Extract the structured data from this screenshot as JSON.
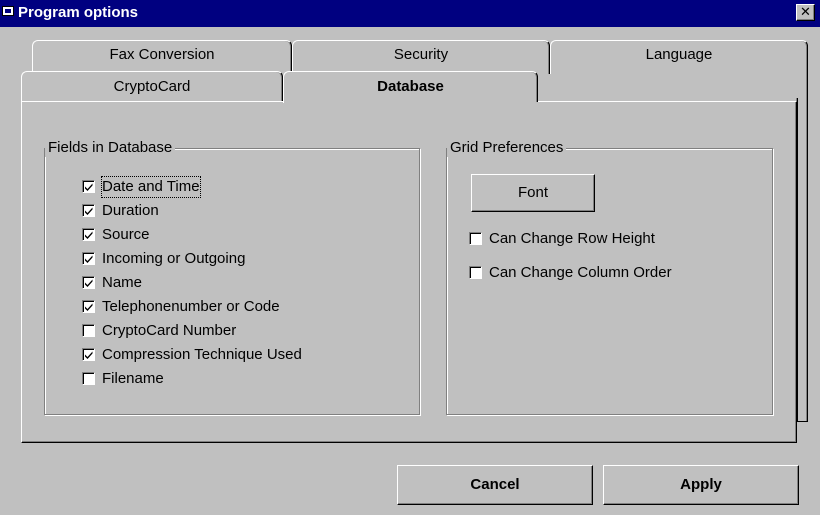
{
  "window": {
    "title": "Program options",
    "close_glyph": "✕"
  },
  "tabs": {
    "back_row": [
      {
        "label": "Fax Conversion"
      },
      {
        "label": "Security"
      },
      {
        "label": "Language"
      }
    ],
    "front_row": [
      {
        "label": "CryptoCard"
      },
      {
        "label": "Database",
        "selected": true
      }
    ]
  },
  "fields_group": {
    "title": "Fields in Database",
    "items": [
      {
        "label": "Date  and Time",
        "checked": true
      },
      {
        "label": "Duration",
        "checked": true
      },
      {
        "label": "Source",
        "checked": true
      },
      {
        "label": "Incoming or Outgoing",
        "checked": true
      },
      {
        "label": "Name",
        "checked": true
      },
      {
        "label": "Telephonenumber or Code",
        "checked": true
      },
      {
        "label": "CryptoCard Number",
        "checked": false
      },
      {
        "label": "Compression Technique Used",
        "checked": true
      },
      {
        "label": "Filename",
        "checked": false
      }
    ]
  },
  "grid_group": {
    "title": "Grid Preferences",
    "font_button": "Font",
    "options": [
      {
        "label": "Can Change Row Height",
        "checked": false
      },
      {
        "label": "Can Change Column Order",
        "checked": false
      }
    ]
  },
  "footer": {
    "cancel_label": "Cancel",
    "apply_label": "Apply"
  }
}
